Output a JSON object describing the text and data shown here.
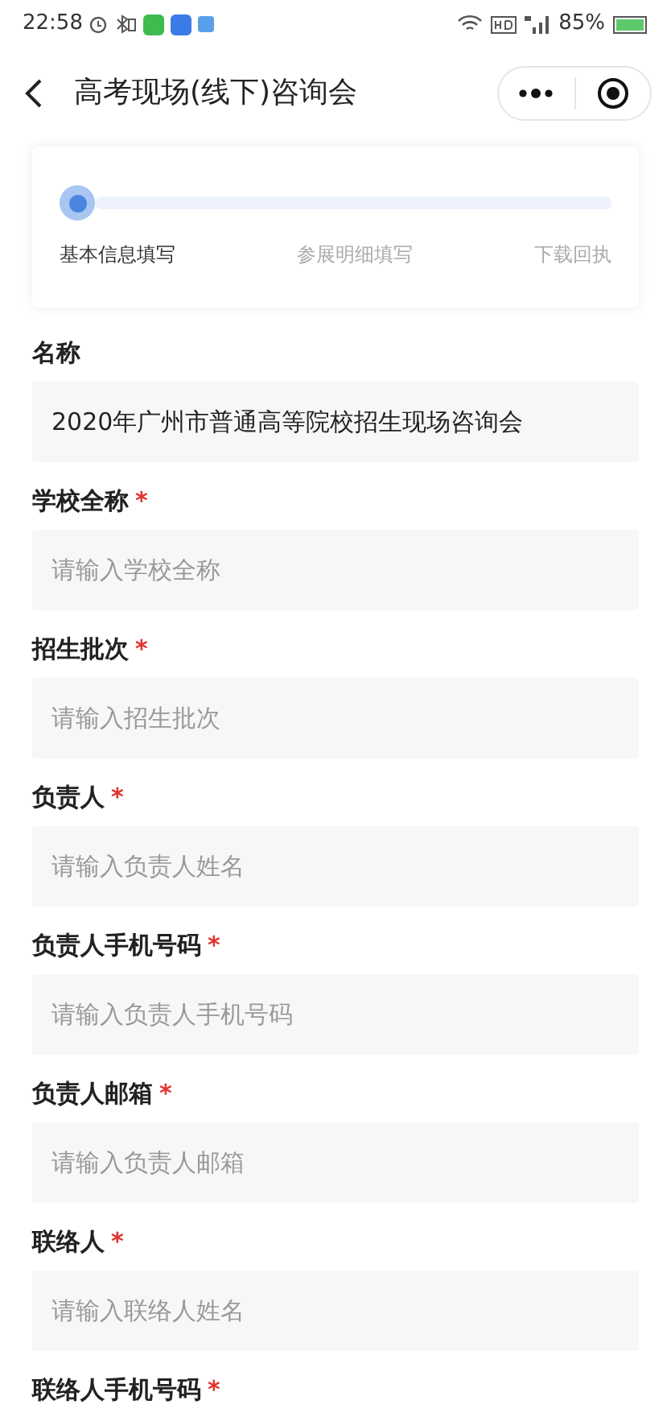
{
  "status_bar": {
    "time": "22:58",
    "battery": "85%"
  },
  "header": {
    "title": "高考现场(线下)咨询会"
  },
  "progress": {
    "steps": [
      {
        "label": "基本信息填写",
        "selected": true
      },
      {
        "label": "参展明细填写",
        "selected": false
      },
      {
        "label": "下载回执",
        "selected": false
      }
    ]
  },
  "fields": [
    {
      "label": "名称",
      "value": "2020年广州市普通高等院校招生现场咨询会"
    },
    {
      "label": "学校全称",
      "required_mark": "*",
      "placeholder": "请输入学校全称"
    },
    {
      "label": "招生批次",
      "required_mark": "*",
      "placeholder": "请输入招生批次"
    },
    {
      "label": "负责人",
      "required_mark": "*",
      "placeholder": "请输入负责人姓名"
    },
    {
      "label": "负责人手机号码",
      "required_mark": "*",
      "placeholder": "请输入负责人手机号码"
    },
    {
      "label": "负责人邮箱",
      "required_mark": "*",
      "placeholder": "请输入负责人邮箱"
    },
    {
      "label": "联络人",
      "required_mark": "*",
      "placeholder": "请输入联络人姓名"
    },
    {
      "label": "联络人手机号码",
      "required_mark": "*"
    }
  ]
}
